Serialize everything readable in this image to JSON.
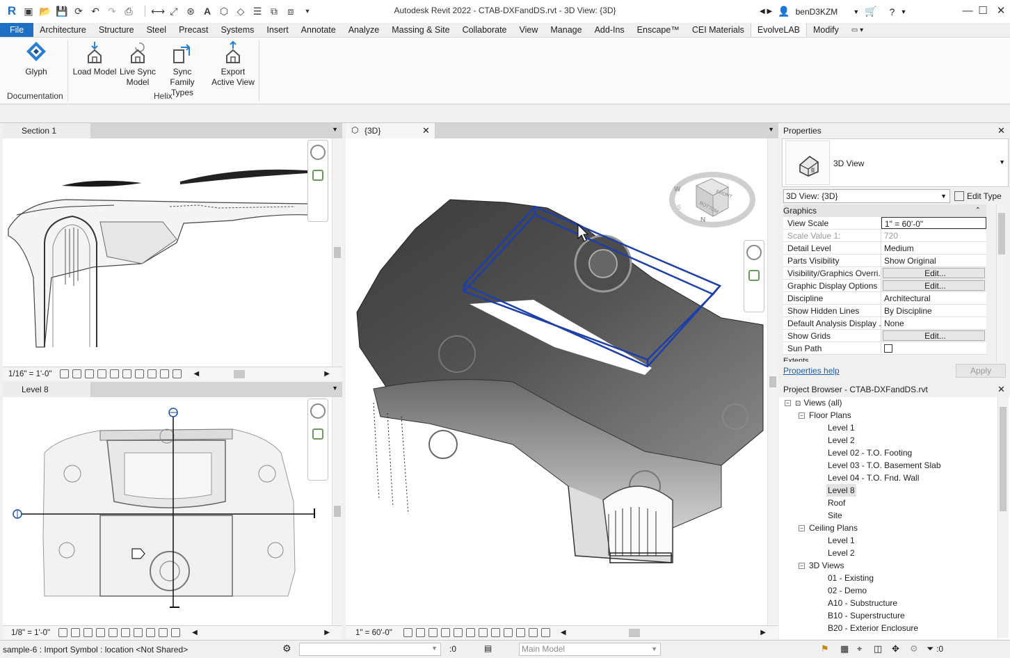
{
  "titlebar": {
    "title": "Autodesk Revit 2022 - CTAB-DXFandDS.rvt - 3D View: {3D}",
    "username": "benD3KZM",
    "minimize": "—",
    "maximize": "☐",
    "close": "✕",
    "accent": "#1f6fc5"
  },
  "menu": {
    "file": "File",
    "tabs": [
      "Architecture",
      "Structure",
      "Steel",
      "Precast",
      "Systems",
      "Insert",
      "Annotate",
      "Analyze",
      "Massing & Site",
      "Collaborate",
      "View",
      "Manage",
      "Add-Ins",
      "Enscape™",
      "CEI Materials",
      "EvolveLAB",
      "Modify"
    ],
    "active_tab": "EvolveLAB"
  },
  "ribbon": {
    "glyph": "Glyph",
    "documentation": "Documentation",
    "load_model": "Load Model",
    "live_sync_1": "Live Sync",
    "live_sync_2": "Model",
    "sync_family_1": "Sync",
    "sync_family_2": "Family Types",
    "export_1": "Export",
    "export_2": "Active View",
    "helix": "Helix"
  },
  "views": {
    "section": {
      "tab": "Section 1",
      "scale": "1/16\" = 1'-0\""
    },
    "level8": {
      "tab": "Level 8",
      "scale": "1/8\" = 1'-0\""
    },
    "view3d": {
      "tab": "{3D}",
      "scale": "1\" = 60'-0\""
    },
    "viewcube": {
      "front": "FRONT",
      "bottom": "BOTTOM",
      "w": "W",
      "n": "N",
      "s": "S"
    }
  },
  "properties": {
    "title": "Properties",
    "type_name": "3D View",
    "selector": "3D View: {3D}",
    "edit_type": "Edit Type",
    "group": "Graphics",
    "rows": [
      {
        "k": "View Scale",
        "v": "1\" = 60'-0\""
      },
      {
        "k": "Scale Value    1:",
        "v": "720"
      },
      {
        "k": "Detail Level",
        "v": "Medium"
      },
      {
        "k": "Parts Visibility",
        "v": "Show Original"
      },
      {
        "k": "Visibility/Graphics Overri...",
        "v": "Edit..."
      },
      {
        "k": "Graphic Display Options",
        "v": "Edit..."
      },
      {
        "k": "Discipline",
        "v": "Architectural"
      },
      {
        "k": "Show Hidden Lines",
        "v": "By Discipline"
      },
      {
        "k": "Default Analysis Display ...",
        "v": "None"
      },
      {
        "k": "Show Grids",
        "v": "Edit..."
      },
      {
        "k": "Sun Path",
        "v": ""
      }
    ],
    "next_group": "Extents",
    "help": "Properties help",
    "apply": "Apply"
  },
  "browser": {
    "title": "Project Browser - CTAB-DXFandDS.rvt",
    "views_all": "Views (all)",
    "floor_plans": "Floor Plans",
    "floor_items": [
      "Level 1",
      "Level 2",
      "Level 02 - T.O. Footing",
      "Level 03 - T.O. Basement Slab",
      "Level 04 - T.O. Fnd. Wall",
      "Level 8",
      "Roof",
      "Site"
    ],
    "ceiling_plans": "Ceiling Plans",
    "ceiling_items": [
      "Level 1",
      "Level 2"
    ],
    "views_3d": "3D Views",
    "items_3d": [
      "01 - Existing",
      "02 - Demo",
      "A10 - Substructure",
      "B10 - Superstructure",
      "B20 - Exterior Enclosure"
    ]
  },
  "status": {
    "message": "sample-6 : Import Symbol : location <Not Shared>",
    "count": ":0",
    "model": "Main Model",
    "filter_count": ":0"
  }
}
